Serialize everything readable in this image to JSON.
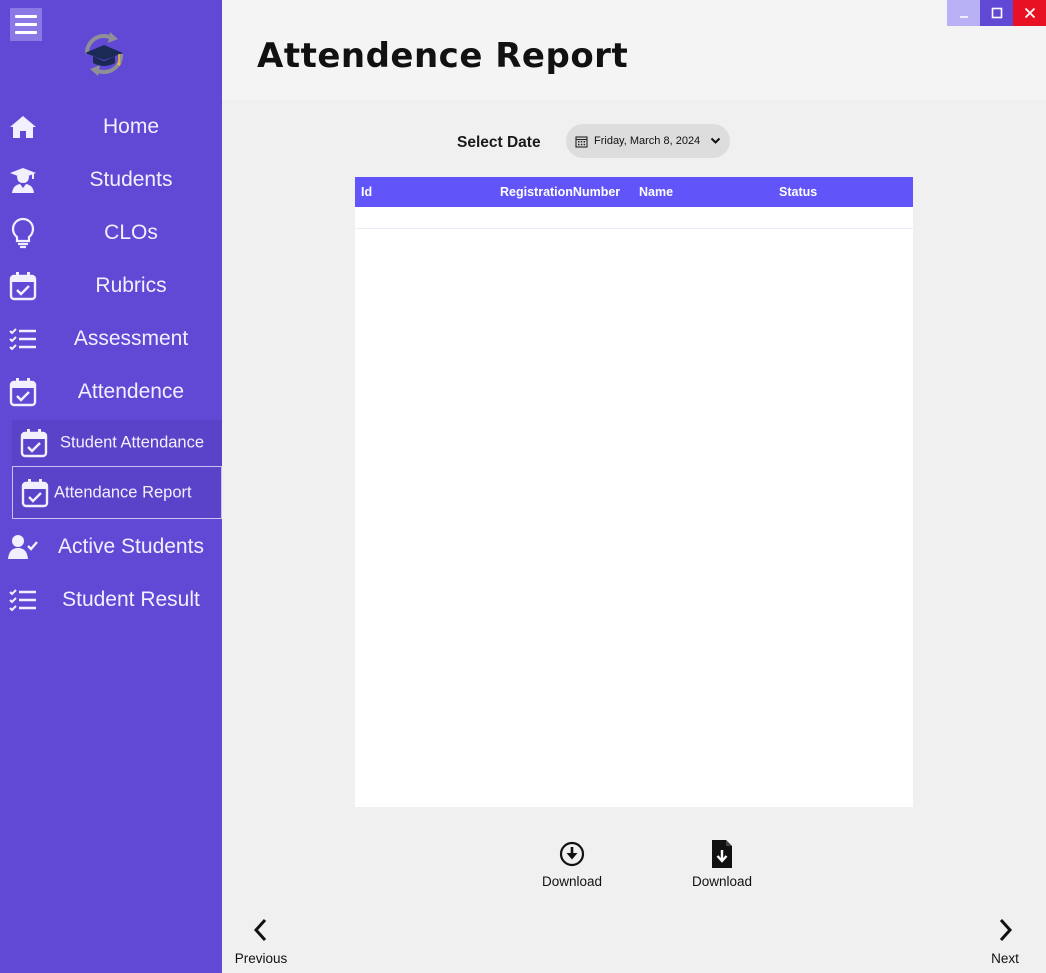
{
  "header": {
    "title": "Attendence Report"
  },
  "window": {
    "minimize": "_",
    "maximize": "☐",
    "close": "✕"
  },
  "sidebar": {
    "items": [
      {
        "label": "Home",
        "icon": "home-icon"
      },
      {
        "label": "Students",
        "icon": "student-icon"
      },
      {
        "label": "CLOs",
        "icon": "lightbulb-icon"
      },
      {
        "label": "Rubrics",
        "icon": "calendar-check-icon"
      },
      {
        "label": "Assessment",
        "icon": "checklist-icon"
      },
      {
        "label": "Attendence",
        "icon": "calendar-check-icon"
      },
      {
        "label": "Active Students",
        "icon": "user-check-icon"
      },
      {
        "label": "Student Result",
        "icon": "checklist-icon"
      }
    ],
    "subitems": [
      {
        "label": "Student Attendance",
        "icon": "calendar-check-icon"
      },
      {
        "label": "Attendance Report",
        "icon": "calendar-check-icon",
        "selected": true
      }
    ]
  },
  "filter": {
    "label": "Select Date",
    "date": "Friday, March 8, 2024"
  },
  "table": {
    "columns": [
      "Id",
      "RegistrationNumber",
      "Name",
      "Status"
    ],
    "rows": []
  },
  "actions": {
    "download_1": "Download",
    "download_2": "Download",
    "previous": "Previous",
    "next": "Next"
  },
  "colors": {
    "sidebar": "#6149d6",
    "accent": "#6155fa",
    "close": "#e81123"
  }
}
